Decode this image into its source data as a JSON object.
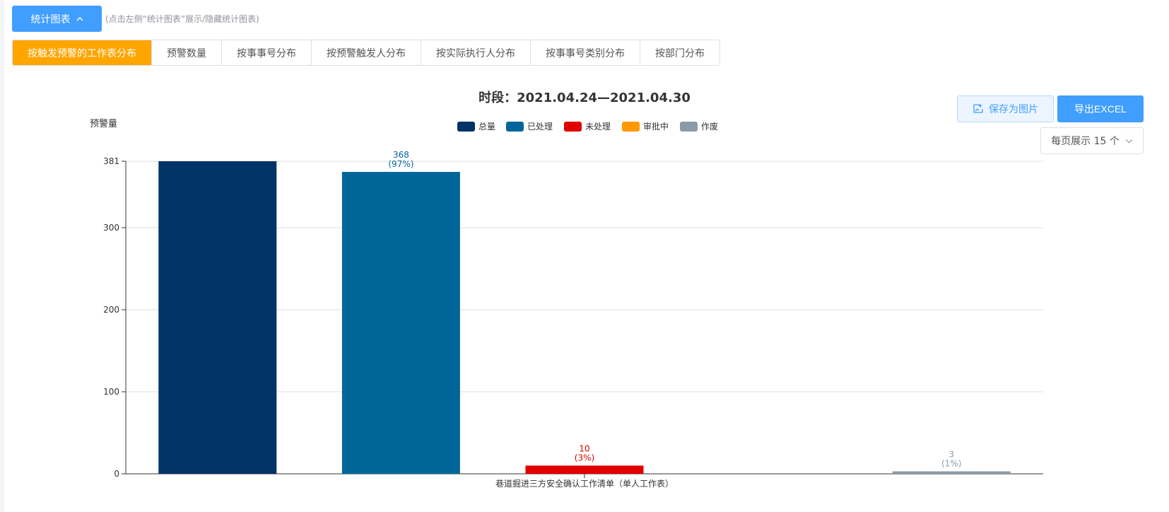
{
  "controls": {
    "toggle_label": "统计图表",
    "hint": "(点击左侧“统计图表”展示/隐藏统计图表)",
    "save_label": "保存为图片",
    "export_label": "导出EXCEL",
    "page_size_label": "每页展示 15 个"
  },
  "tabs": [
    {
      "label": "按触发预警的工作表分布",
      "active": true
    },
    {
      "label": "预警数量",
      "active": false
    },
    {
      "label": "按事事号分布",
      "active": false
    },
    {
      "label": "按预警触发人分布",
      "active": false
    },
    {
      "label": "按实际执行人分布",
      "active": false
    },
    {
      "label": "按事事号类别分布",
      "active": false
    },
    {
      "label": "按部门分布",
      "active": false
    }
  ],
  "colors": {
    "accent": "#409eff",
    "active_tab": "#ffa500"
  },
  "chart_data": {
    "type": "bar",
    "title": "时段：2021.04.24—2021.04.30",
    "ylabel": "预警量",
    "ylim": [
      0,
      381
    ],
    "yticks": [
      0,
      100,
      200,
      300,
      381
    ],
    "categories": [
      "巷道掘进三方安全确认工作清单（单人工作表）"
    ],
    "legend_position": "top-center",
    "grid": true,
    "series": [
      {
        "name": "总量",
        "color": "#003366",
        "values": [
          381
        ],
        "label": null
      },
      {
        "name": "已处理",
        "color": "#006699",
        "values": [
          368
        ],
        "label": [
          "368",
          "(97%)"
        ]
      },
      {
        "name": "未处理",
        "color": "#e00000",
        "values": [
          10
        ],
        "label": [
          "10",
          "(3%)"
        ]
      },
      {
        "name": "审批中",
        "color": "#ff9900",
        "values": [
          0
        ],
        "label": null
      },
      {
        "name": "作废",
        "color": "#8a9aa8",
        "values": [
          3
        ],
        "label": [
          "3",
          "(1%)"
        ]
      }
    ]
  }
}
